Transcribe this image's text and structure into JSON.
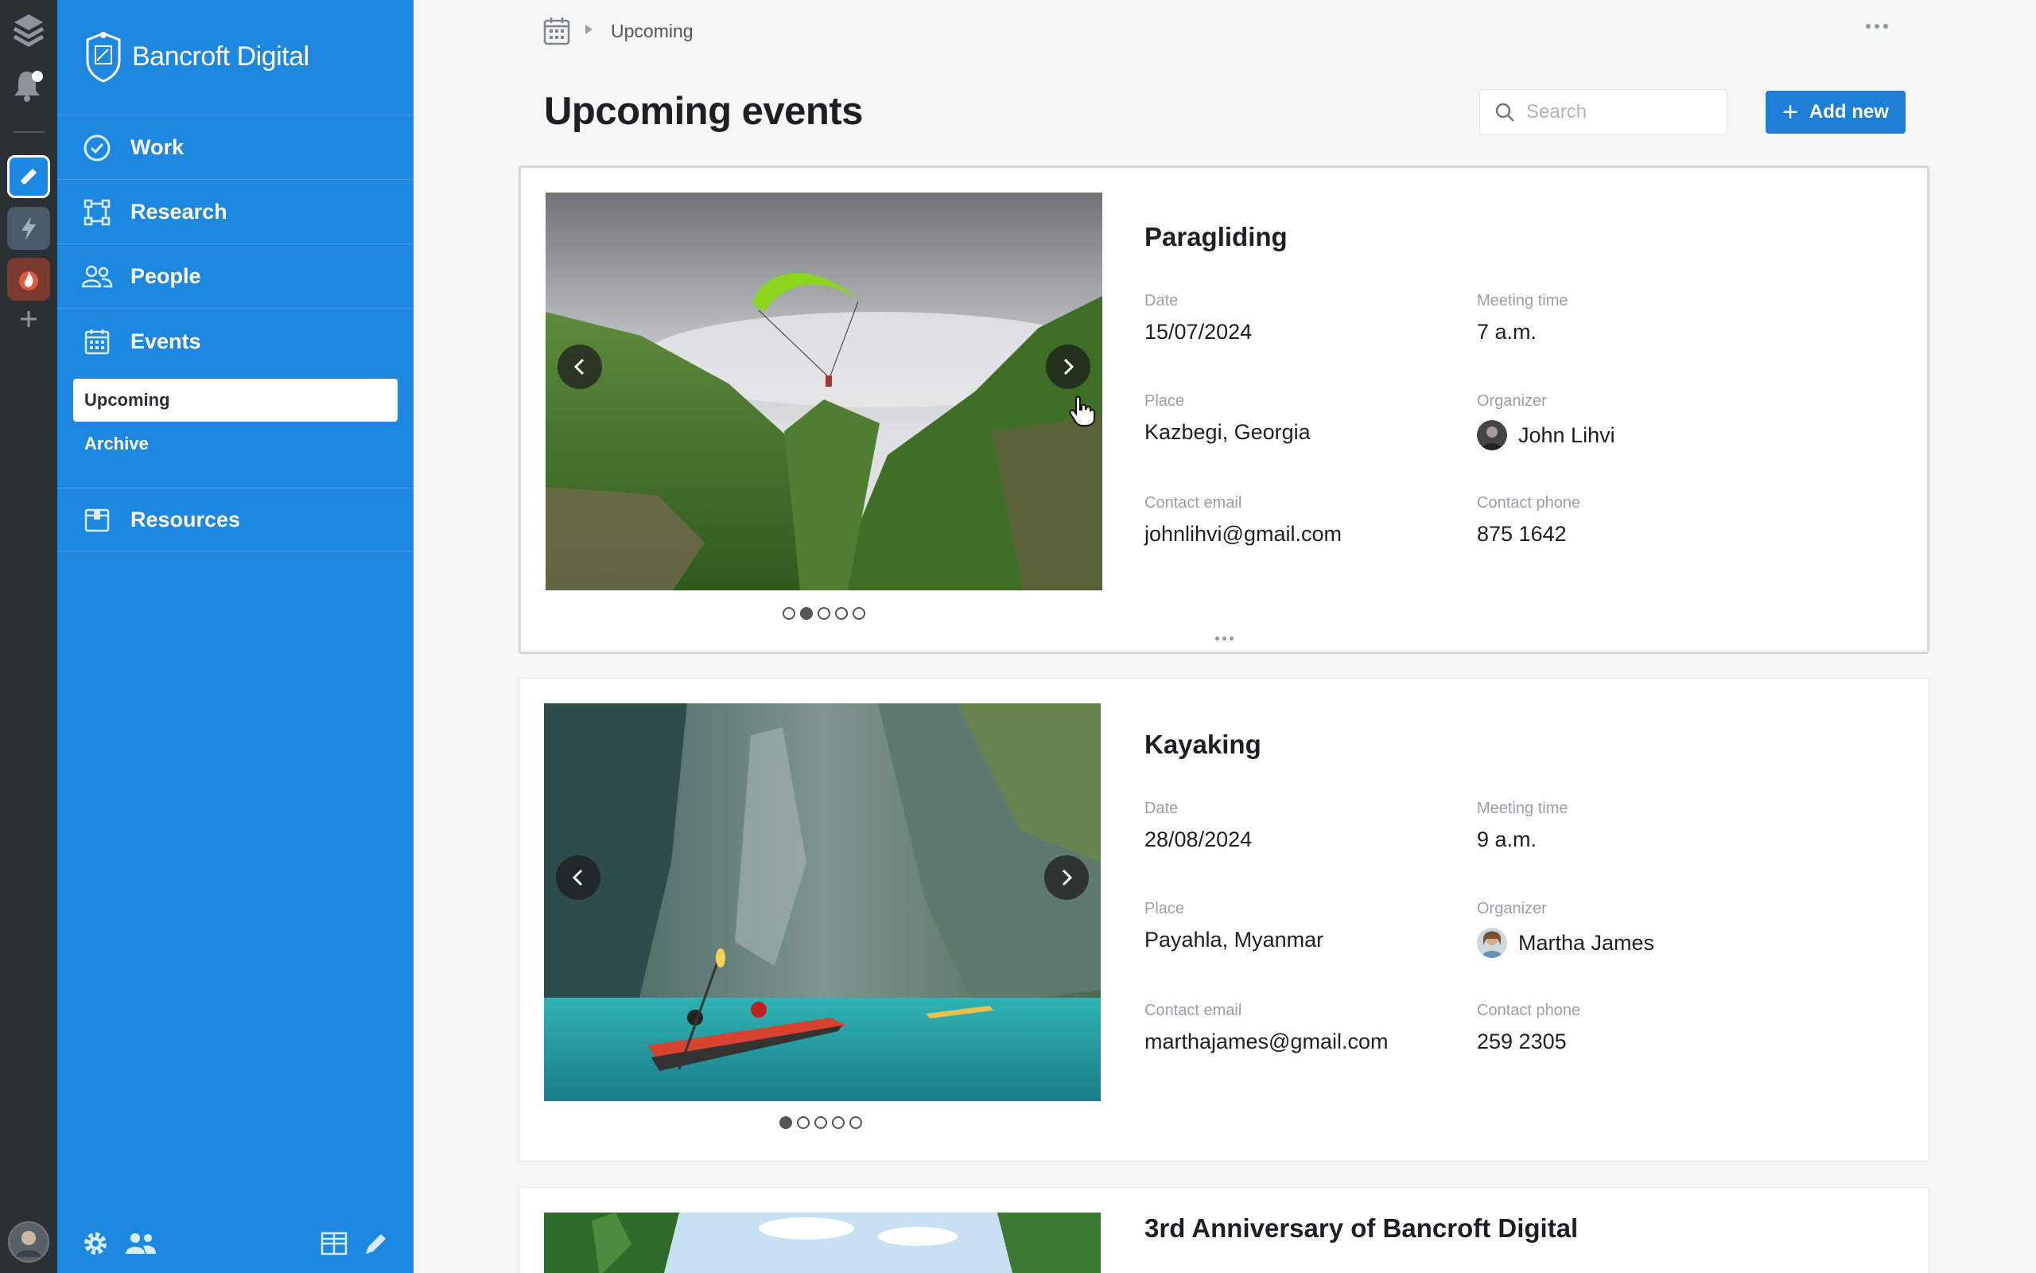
{
  "brand": {
    "name": "Bancroft Digital"
  },
  "nav": [
    {
      "label": "Work",
      "icon": "check-circle-icon"
    },
    {
      "label": "Research",
      "icon": "bounding-box-icon"
    },
    {
      "label": "People",
      "icon": "people-icon"
    },
    {
      "label": "Events",
      "icon": "calendar-icon"
    },
    {
      "label": "Resources",
      "icon": "box-icon"
    }
  ],
  "events_sub": [
    {
      "label": "Upcoming",
      "active": true
    },
    {
      "label": "Archive",
      "active": false
    }
  ],
  "breadcrumb": {
    "current": "Upcoming"
  },
  "page": {
    "title": "Upcoming events"
  },
  "search": {
    "placeholder": "Search"
  },
  "actions": {
    "add_label": "Add new"
  },
  "field_labels": {
    "date": "Date",
    "meeting_time": "Meeting time",
    "place": "Place",
    "organizer": "Organizer",
    "contact_email": "Contact email",
    "contact_phone": "Contact phone"
  },
  "events": [
    {
      "title": "Paragliding",
      "date": "15/07/2024",
      "meeting_time": "7 a.m.",
      "place": "Kazbegi, Georgia",
      "organizer": "John Lihvi",
      "contact_email": "johnlihvi@gmail.com",
      "contact_phone": "875 1642",
      "active_slide": 2,
      "slide_count": 5
    },
    {
      "title": "Kayaking",
      "date": "28/08/2024",
      "meeting_time": "9 a.m.",
      "place": "Payahla, Myanmar",
      "organizer": "Martha James",
      "contact_email": "marthajames@gmail.com",
      "contact_phone": "259 2305",
      "active_slide": 1,
      "slide_count": 5
    },
    {
      "title": "3rd Anniversary of Bancroft Digital"
    }
  ],
  "colors": {
    "sidebar": "#1e88e0",
    "rail": "#2b3035",
    "accent": "#1e7fd6",
    "background": "#f5f6f6"
  }
}
